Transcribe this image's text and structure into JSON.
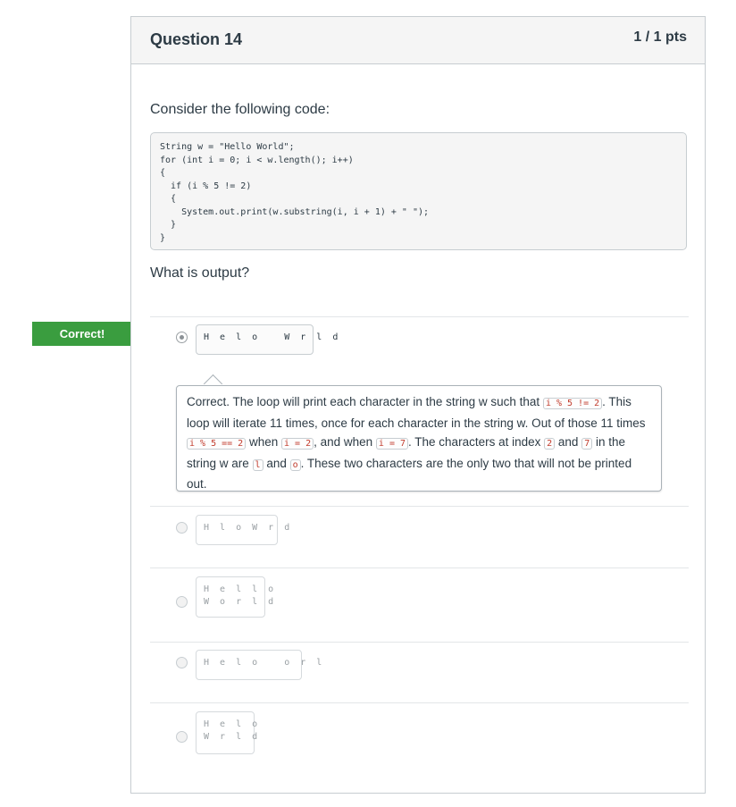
{
  "question": {
    "title": "Question 14",
    "points": "1 / 1 pts",
    "prompt": "Consider the following code:",
    "code": "String w = \"Hello World\";\nfor (int i = 0; i < w.length(); i++)\n{\n  if (i % 5 != 2)\n  {\n    System.out.print(w.substring(i, i + 1) + \" \");\n  }\n}",
    "ask": "What is output?"
  },
  "correct_flag": "Correct!",
  "answers": [
    {
      "text": "H e l o   W r l d",
      "selected": true
    },
    {
      "text": "H l o W r d",
      "selected": false
    },
    {
      "text": "H e l l o\nW o r l d",
      "selected": false
    },
    {
      "text": "H e l o   o r l",
      "selected": false
    },
    {
      "text": "H e l o\nW r l d",
      "selected": false
    }
  ],
  "feedback": {
    "t1": "Correct. The loop will print each character in the string w such that ",
    "c1": "i % 5 != 2",
    "t2": ". This loop will iterate 11 times, once for each character in the string w. Out of those 11 times ",
    "c2": "i % 5 == 2",
    "t3": " when ",
    "c3": "i = 2",
    "t4": ", and when ",
    "c4": "i = 7",
    "t5": ". The characters at index ",
    "c5": "2",
    "t6": " and ",
    "c6": "7",
    "t7": " in the string w are ",
    "c7": "l",
    "t8": " and ",
    "c8": "o",
    "t9": ". These two characters are the only two that will not be printed out."
  }
}
